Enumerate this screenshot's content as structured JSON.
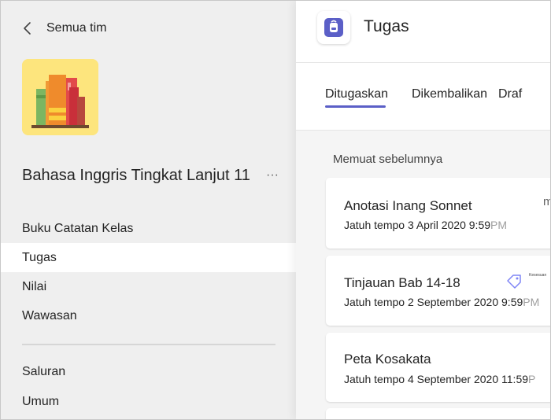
{
  "sidebar": {
    "back_label": "Semua tim",
    "team_name": "Bahasa Inggris Tingkat Lanjut 11",
    "team_more": "···",
    "nav_items": [
      {
        "label": "Buku Catatan Kelas",
        "active": false
      },
      {
        "label": "Tugas",
        "active": true
      },
      {
        "label": "Nilai",
        "active": false
      },
      {
        "label": "Wawasan",
        "active": false
      }
    ],
    "channels": [
      "Saluran",
      "Umum"
    ]
  },
  "header": {
    "title": "Tugas",
    "icon": "backpack-icon",
    "accent": "#5b5fc7"
  },
  "tabs": [
    {
      "label": "Ditugaskan",
      "active": true
    },
    {
      "label": "Dikembalikan",
      "active": false
    },
    {
      "label": "Draf",
      "active": false
    }
  ],
  "load_previous": "Memuat sebelumnya",
  "assignments": [
    {
      "title": "Anotasi Inang Sonnet",
      "due": "Jatuh tempo 3 April 2020 9:59",
      "due_suffix": "PM",
      "trailing": "m"
    },
    {
      "title": "Tinjauan Bab 14-18",
      "due": "Jatuh tempo 2 September 2020 9:59",
      "due_suffix": "PM",
      "tag_label": "Kesesuan"
    },
    {
      "title": "Peta Kosakata",
      "due": "Jatuh tempo 4 September 2020 11:59",
      "due_suffix": "P"
    }
  ]
}
